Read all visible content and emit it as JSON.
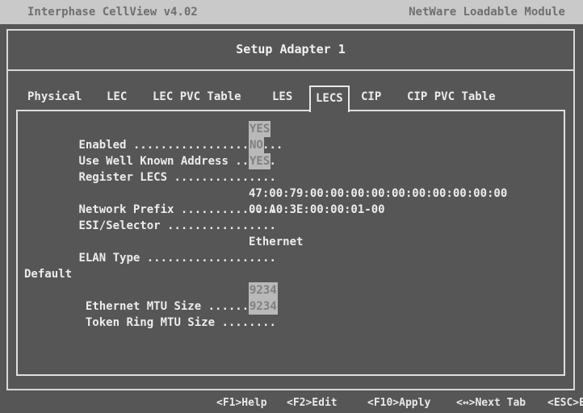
{
  "title_bar": {
    "app_title": "Interphase CellView  v4.02",
    "module_label": "NetWare Loadable Module"
  },
  "dialog": {
    "title": "Setup Adapter 1"
  },
  "tabs": [
    {
      "label": "Physical"
    },
    {
      "label": "LEC"
    },
    {
      "label": "LEC PVC Table"
    },
    {
      "label": "LES"
    },
    {
      "label": "LECS"
    },
    {
      "label": "CIP"
    },
    {
      "label": "CIP PVC Table"
    }
  ],
  "active_tab": "LECS",
  "fields": {
    "enabled": {
      "label": "Enabled ......................",
      "value": "YES"
    },
    "use_well_known": {
      "label": "Use Well Known Address ......",
      "value": "NO"
    },
    "register_lecs": {
      "label": "Register LECS ...............",
      "value": "YES"
    },
    "network_prefix": {
      "label": "Network Prefix ..............",
      "value": "47:00:79:00:00:00:00:00:00:00:00:00:00"
    },
    "esi_selector": {
      "label": "ESI/Selector ................",
      "value": "00:A0:3E:00:00:01-00"
    },
    "elan_type": {
      "label": "ELAN Type ...................",
      "value": "Ethernet"
    },
    "default_heading": "Default",
    "ethernet_mtu": {
      "label": " Ethernet MTU Size ..........",
      "value": "9234"
    },
    "token_ring_mtu": {
      "label": " Token Ring MTU Size ........",
      "value": "9234"
    }
  },
  "footer": {
    "help": "<F1>Help",
    "edit": "<F2>Edit",
    "apply": "<F10>Apply",
    "next_tab": "<↔>Next Tab",
    "esc": "<ESC>E"
  }
}
